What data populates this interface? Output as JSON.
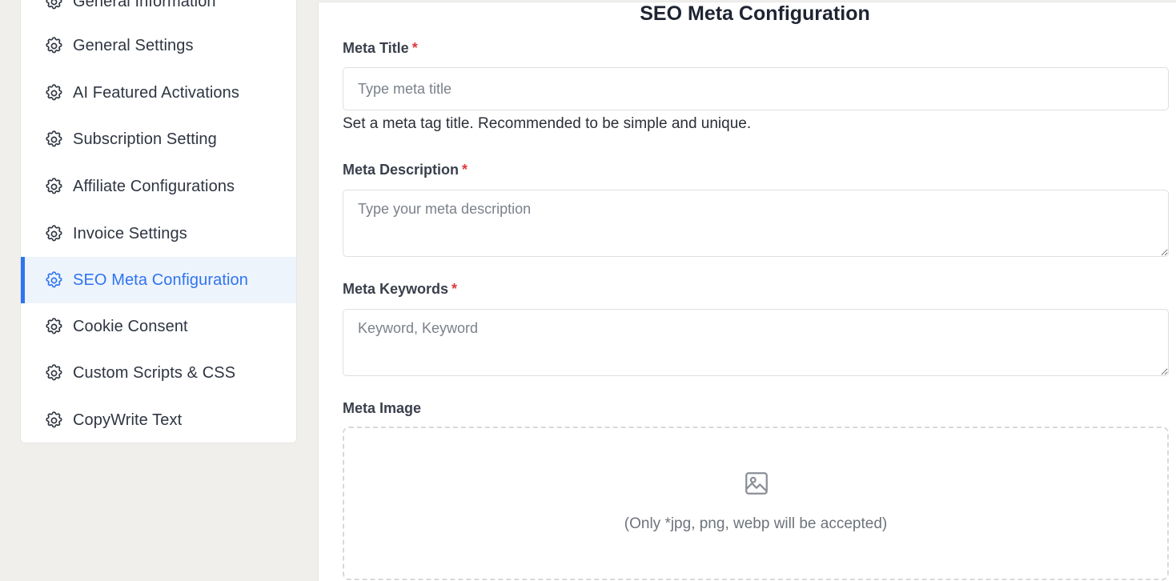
{
  "sidebar": {
    "items": [
      {
        "label": "General Information",
        "icon": "gear-icon"
      },
      {
        "label": "General Settings",
        "icon": "gear-icon"
      },
      {
        "label": "AI Featured Activations",
        "icon": "gear-icon"
      },
      {
        "label": "Subscription Setting",
        "icon": "gear-icon"
      },
      {
        "label": "Affiliate Configurations",
        "icon": "gear-icon"
      },
      {
        "label": "Invoice Settings",
        "icon": "gear-icon"
      },
      {
        "label": "SEO Meta Configuration",
        "icon": "gear-icon",
        "active": true
      },
      {
        "label": "Cookie Consent",
        "icon": "gear-icon"
      },
      {
        "label": "Custom Scripts & CSS",
        "icon": "gear-icon"
      },
      {
        "label": "CopyWrite Text",
        "icon": "gear-icon"
      }
    ]
  },
  "main": {
    "title": "SEO Meta Configuration",
    "meta_title": {
      "label": "Meta Title",
      "required_mark": "*",
      "placeholder": "Type meta title",
      "value": "",
      "help": "Set a meta tag title. Recommended to be simple and unique."
    },
    "meta_description": {
      "label": "Meta Description",
      "required_mark": "*",
      "placeholder": "Type your meta description",
      "value": ""
    },
    "meta_keywords": {
      "label": "Meta Keywords",
      "required_mark": "*",
      "placeholder": "Keyword, Keyword",
      "value": ""
    },
    "meta_image": {
      "label": "Meta Image",
      "icon": "image-icon",
      "hint": "(Only *jpg, png, webp will be accepted)"
    }
  },
  "colors": {
    "accent": "#2f74f0",
    "active_bg": "#eef4fc",
    "required": "#e0393e",
    "page_bg": "#f0efeb"
  }
}
